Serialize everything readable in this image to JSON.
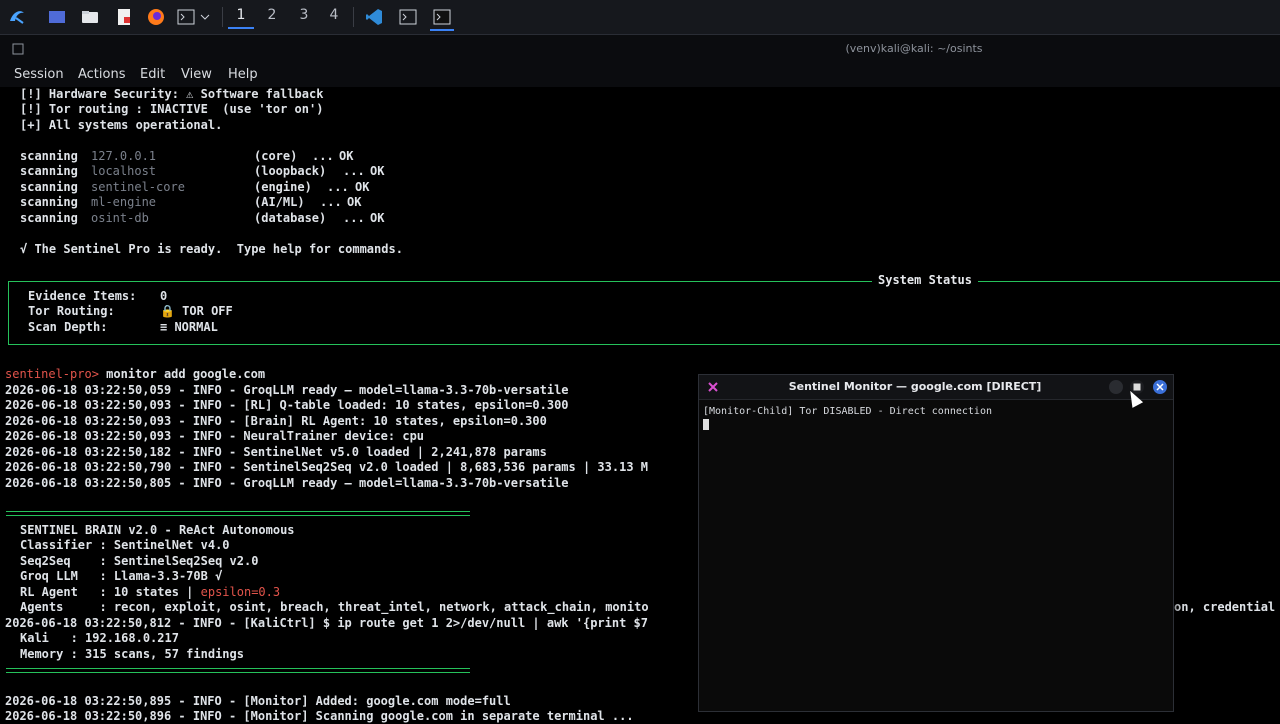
{
  "panel": {
    "workspaces": [
      "1",
      "2",
      "3",
      "4"
    ],
    "icons": [
      "kali-menu-icon",
      "desktop-icon",
      "file-manager-icon",
      "text-editor-icon",
      "firefox-icon",
      "terminal-icon",
      "chevron-down-icon",
      "vscode-icon",
      "terminal-icon",
      "terminal-icon"
    ]
  },
  "window": {
    "title": "(venv)kali@kali: ~/osints"
  },
  "menu": [
    "Session",
    "Actions",
    "Edit",
    "View",
    "Help"
  ],
  "terminal": {
    "header_lines": [
      "[!] Hardware Security: ⚠ Software fallback",
      "[!] Tor routing : INACTIVE  (use 'tor on')",
      "[+] All systems operational."
    ],
    "scan_lines": [
      {
        "label": "scanning",
        "target": "127.0.0.1",
        "role": "(core)",
        "dots": "...",
        "status": "OK"
      },
      {
        "label": "scanning",
        "target": "localhost",
        "role": "(loopback)",
        "dots": "...",
        "status": "OK"
      },
      {
        "label": "scanning",
        "target": "sentinel-core",
        "role": "(engine)",
        "dots": "...",
        "status": "OK"
      },
      {
        "label": "scanning",
        "target": "ml-engine",
        "role": "(AI/ML)",
        "dots": "...",
        "status": "OK"
      },
      {
        "label": "scanning",
        "target": "osint-db",
        "role": "(database)",
        "dots": "...",
        "status": "OK"
      }
    ],
    "ready_line": {
      "prefix": "√ The Sentinel Pro is ready.  Type ",
      "cmd": "help",
      "suffix": " for commands."
    },
    "status_box": {
      "title": "System Status",
      "rows": [
        {
          "key": "Evidence Items:",
          "value": "0"
        },
        {
          "key": "Tor Routing:",
          "value": "🔒 TOR OFF"
        },
        {
          "key": "Scan Depth:",
          "value": "≡ NORMAL"
        }
      ]
    },
    "prompt": {
      "name": "sentinel-pro>",
      "command": " monitor add google.com"
    },
    "log_lines": [
      "2026-06-18 03:22:50,059 - INFO - GroqLLM ready — model=llama-3.3-70b-versatile",
      "2026-06-18 03:22:50,093 - INFO - [RL] Q-table loaded: 10 states, epsilon=0.300",
      "2026-06-18 03:22:50,093 - INFO - [Brain] RL Agent: 10 states, epsilon=0.300",
      "2026-06-18 03:22:50,093 - INFO - NeuralTrainer device: cpu",
      "2026-06-18 03:22:50,182 - INFO - SentinelNet v5.0 loaded | 2,241,878 params",
      "2026-06-18 03:22:50,790 - INFO - SentinelSeq2Seq v2.0 loaded | 8,683,536 params | 33.13 M",
      "2026-06-18 03:22:50,805 - INFO - GroqLLM ready — model=llama-3.3-70b-versatile"
    ],
    "brain": {
      "title": "SENTINEL BRAIN v2.0 - ReAct Autonomous",
      "classifier": "Classifier : SentinelNet v4.0",
      "seq2seq": "Seq2Seq    : SentinelSeq2Seq v2.0",
      "groq": "Groq LLM   : Llama-3.3-70B √",
      "rl_prefix": "RL Agent   : 10 states | ",
      "rl_eps": "epsilon=0.3",
      "agents": "Agents     : recon, exploit, osint, breach, threat_intel, network, attack_chain, monito",
      "agents_tail": "on, credential",
      "kali_log": "2026-06-18 03:22:50,812 - INFO - [KaliCtrl] $ ip route get 1 2>/dev/null | awk '{print $7",
      "kali": "Kali   : 192.168.0.217",
      "memory": "Memory : 315 scans, 57 findings"
    },
    "tail_lines": [
      "2026-06-18 03:22:50,895 - INFO - [Monitor] Added: google.com mode=full",
      "2026-06-18 03:22:50,896 - INFO - [Monitor] Scanning google.com in separate terminal ..."
    ]
  },
  "monitor": {
    "title": "Sentinel Monitor — google.com [DIRECT]",
    "line": "[Monitor-Child] Tor DISABLED - Direct connection"
  },
  "colors": {
    "accent_green": "#25c15a",
    "prompt_red": "#e2544b",
    "panel_bg": "#16181d"
  }
}
